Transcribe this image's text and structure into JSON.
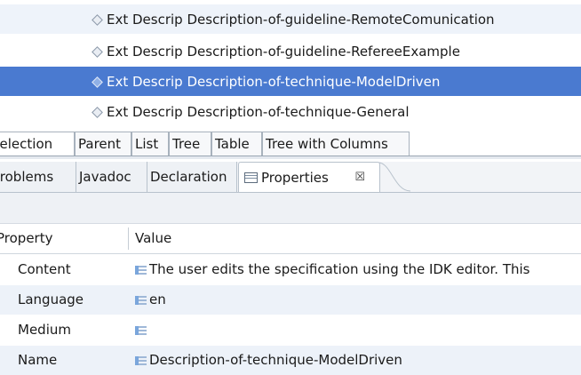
{
  "tree": {
    "items": [
      {
        "label": "Ext Descrip Description-of-guideline-RemoteComunication"
      },
      {
        "label": "Ext Descrip Description-of-guideline-RefereeExample"
      },
      {
        "label": "Ext Descrip Description-of-technique-ModelDriven"
      },
      {
        "label": "Ext Descrip Description-of-technique-General"
      }
    ],
    "selected_index": 2
  },
  "viewer_tabs": {
    "items": [
      {
        "label": "Selection"
      },
      {
        "label": "Parent"
      },
      {
        "label": "List"
      },
      {
        "label": "Tree"
      },
      {
        "label": "Table"
      },
      {
        "label": "Tree with Columns"
      }
    ],
    "active_index": 0
  },
  "view_tabs": {
    "items": [
      {
        "label": "Problems"
      },
      {
        "label": "Javadoc"
      },
      {
        "label": "Declaration"
      },
      {
        "label": "Properties",
        "icon": "properties-icon",
        "close": "☒"
      }
    ],
    "active_index": 3
  },
  "properties": {
    "columns": [
      "Property",
      "Value"
    ],
    "rows": [
      {
        "key": "Content",
        "value": "The user edits the specification using the IDK editor. This"
      },
      {
        "key": "Language",
        "value": "en"
      },
      {
        "key": "Medium",
        "value": ""
      },
      {
        "key": "Name",
        "value": "Description-of-technique-ModelDriven"
      }
    ]
  },
  "colors": {
    "selection": "#4a7ad0",
    "stripe": "#eef3fa"
  }
}
